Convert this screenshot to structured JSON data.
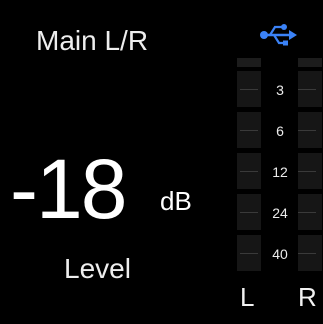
{
  "display": {
    "title": "Main L/R",
    "status_icon": "usb-icon",
    "accent_color": "#3b82f6"
  },
  "level": {
    "value": "-18",
    "unit": "dB",
    "label": "Level"
  },
  "meter": {
    "scale": [
      "3",
      "6",
      "12",
      "24",
      "40"
    ],
    "channels": [
      "L",
      "R"
    ],
    "left_level": 0,
    "right_level": 0
  }
}
